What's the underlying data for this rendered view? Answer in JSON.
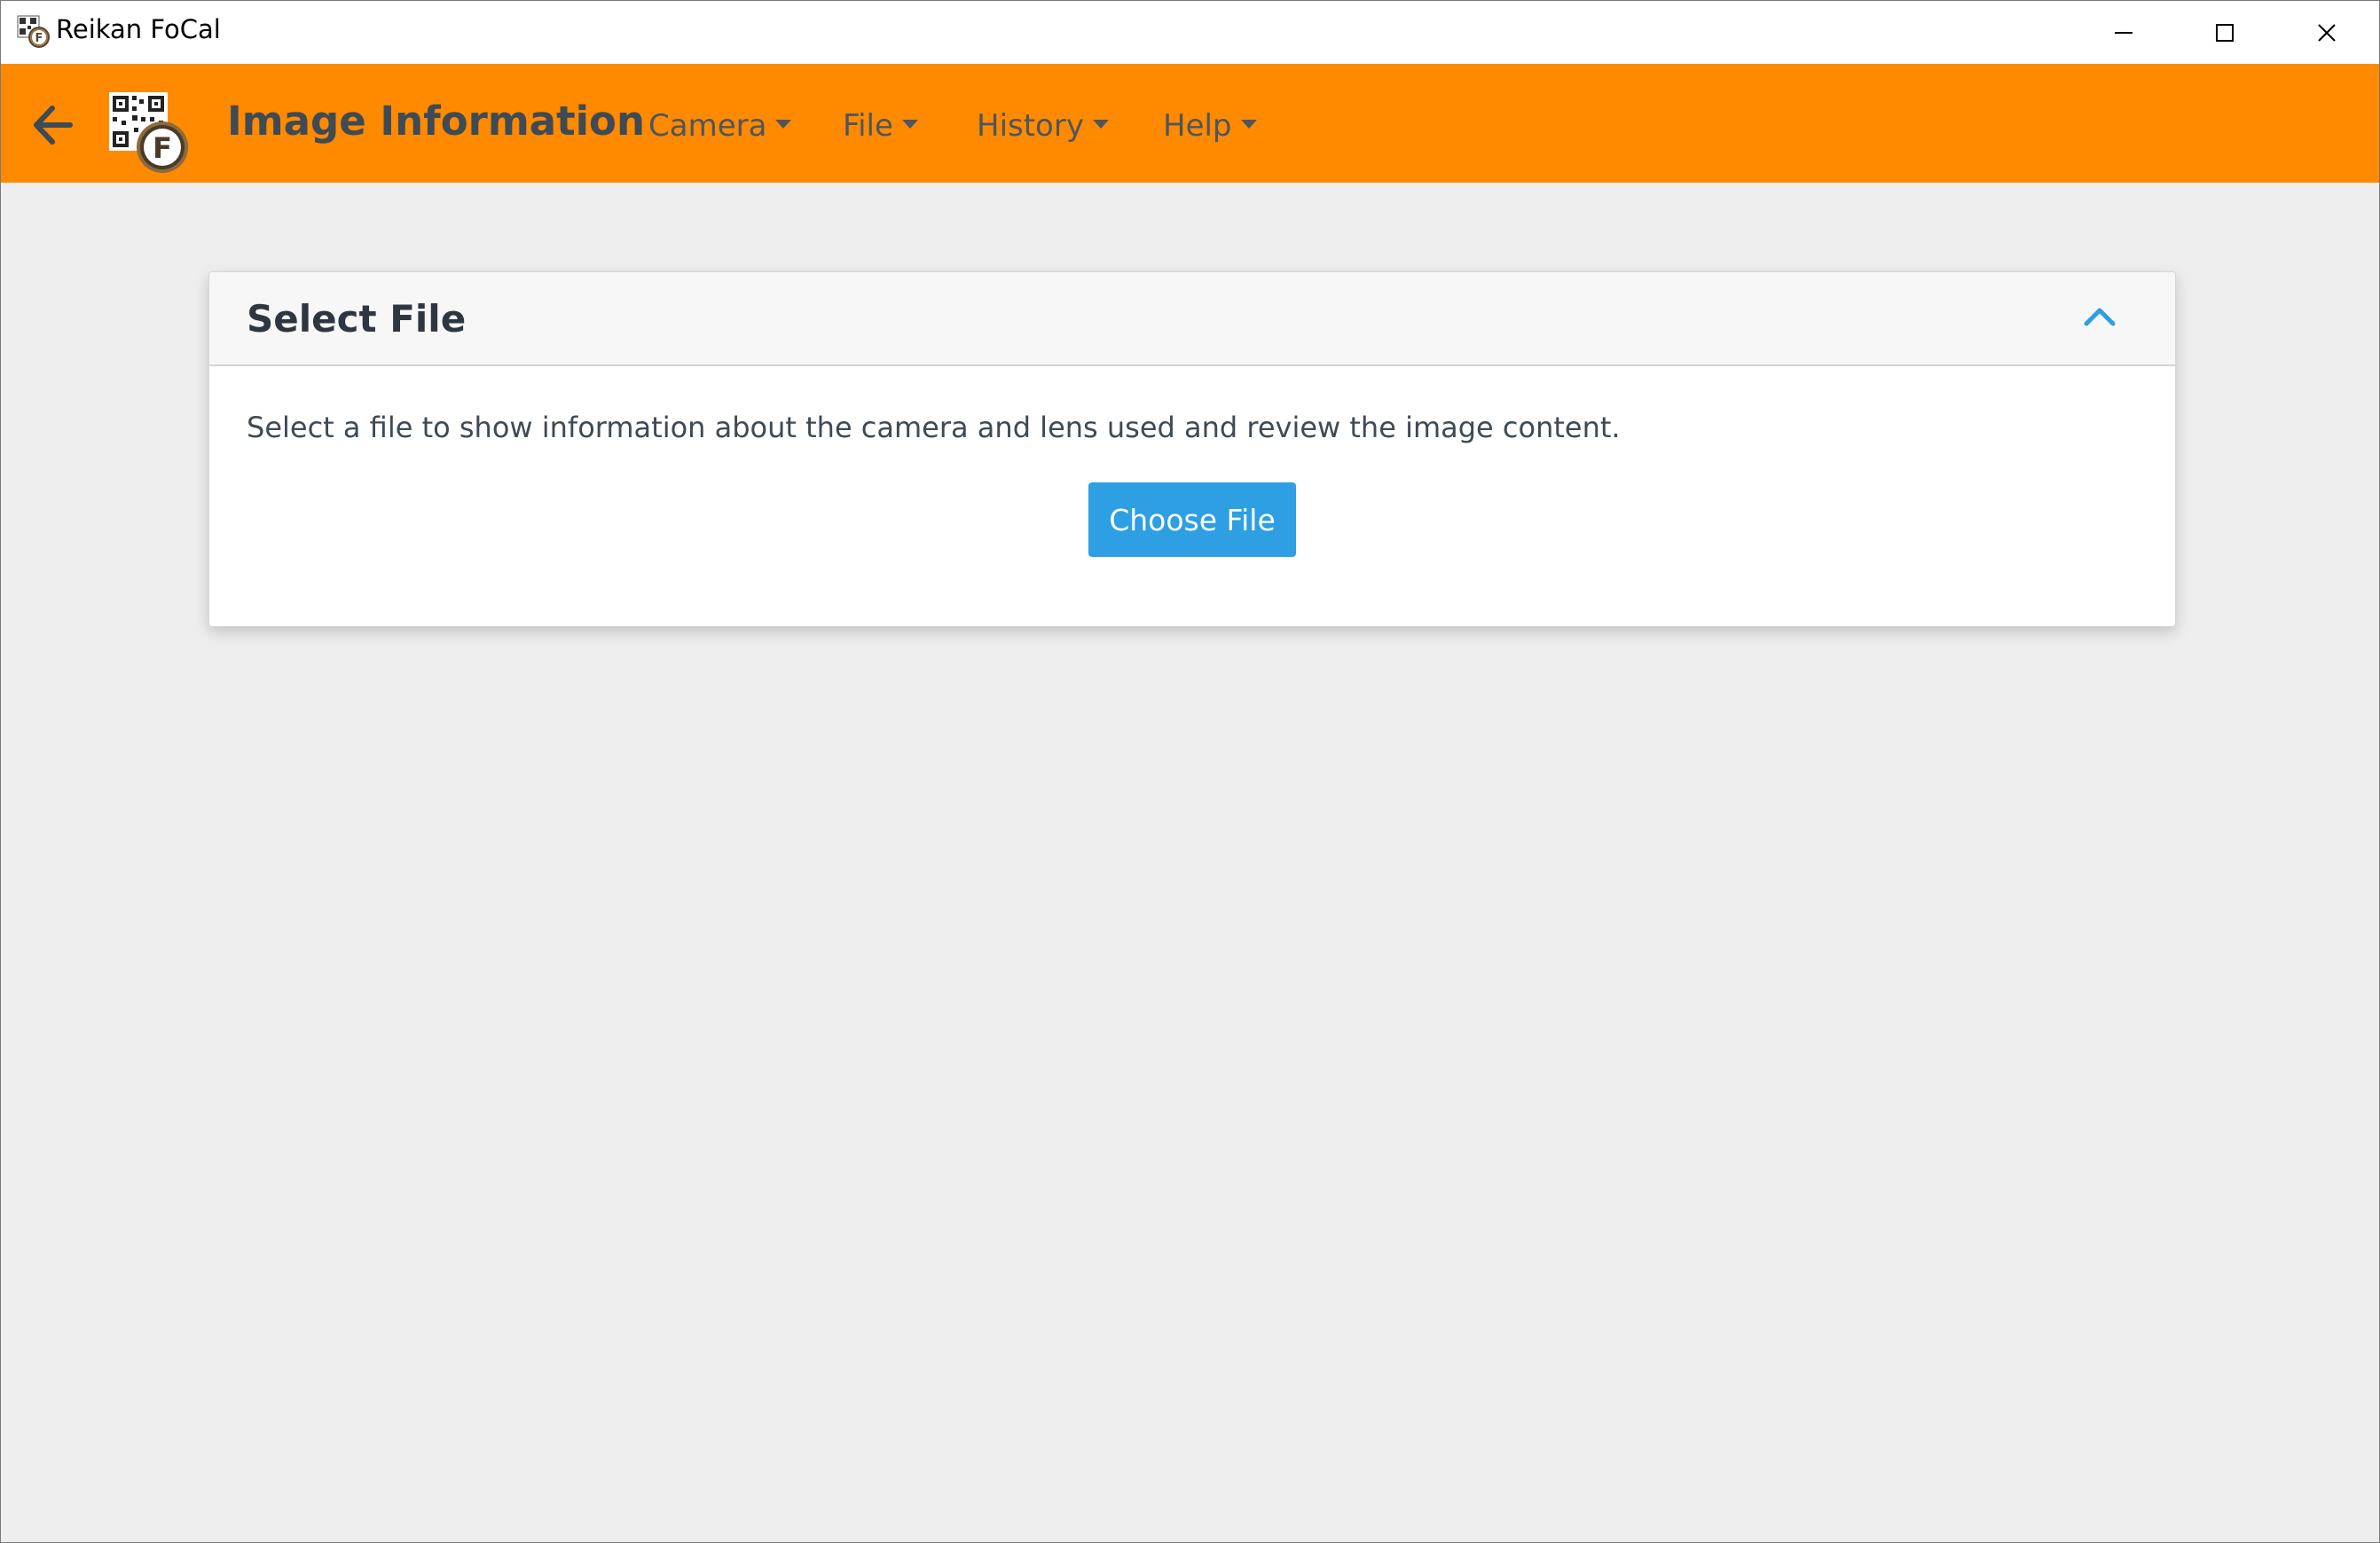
{
  "window": {
    "title": "Reikan FoCal",
    "app_icon": "reikan-focal-icon",
    "controls": {
      "minimize_icon": "minimize-icon",
      "maximize_icon": "maximize-icon",
      "close_icon": "close-icon"
    }
  },
  "header": {
    "background_color": "#ff8a00",
    "back_icon": "arrow-left-icon",
    "logo_icon": "focal-qr-logo-icon",
    "title": "Image Information",
    "menu": [
      {
        "label": "Camera"
      },
      {
        "label": "File"
      },
      {
        "label": "History"
      },
      {
        "label": "Help"
      }
    ]
  },
  "panel": {
    "title": "Select File",
    "collapse_icon": "chevron-up-icon",
    "description": "Select a file to show information about the camera and lens used and review the image content.",
    "button_label": "Choose File",
    "button_color": "#2d9fe2"
  }
}
